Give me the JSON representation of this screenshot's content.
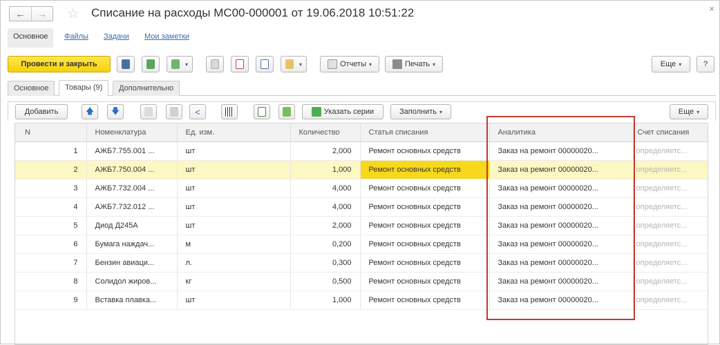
{
  "window": {
    "title": "Списание на расходы МС00-000001 от 19.06.2018 10:51:22",
    "back": "←",
    "forward": "→",
    "star": "☆",
    "close": "×"
  },
  "section_nav": {
    "active": "Основное",
    "links": [
      "Файлы",
      "Задачи",
      "Мои заметки"
    ]
  },
  "toolbar": {
    "post_close": "Провести и закрыть",
    "reports": "Отчеты",
    "print": "Печать",
    "more": "Еще",
    "help": "?"
  },
  "tabs": [
    "Основное",
    "Товары (9)",
    "Дополнительно"
  ],
  "grid_toolbar": {
    "add": "Добавить",
    "series": "Указать серии",
    "fill": "Заполнить",
    "more": "Еще"
  },
  "table": {
    "columns": [
      "N",
      "Номенклатура",
      "Ед. изм.",
      "Количество",
      "Статья списания",
      "Аналитика",
      "Счет списания"
    ],
    "selected_row": 1,
    "rows": [
      {
        "n": "1",
        "item": "АЖБ7.755.001 ...",
        "unit": "шт",
        "qty": "2,000",
        "article": "Ремонт основных средств",
        "analytics": "Заказ на ремонт 00000020...",
        "account": "определяетс..."
      },
      {
        "n": "2",
        "item": "АЖБ7.750.004 ...",
        "unit": "шт",
        "qty": "1,000",
        "article": "Ремонт основных средств",
        "analytics": "Заказ на ремонт 00000020...",
        "account": "определяетс..."
      },
      {
        "n": "3",
        "item": "АЖБ7.732.004 ...",
        "unit": "шт",
        "qty": "4,000",
        "article": "Ремонт основных средств",
        "analytics": "Заказ на ремонт 00000020...",
        "account": "определяетс..."
      },
      {
        "n": "4",
        "item": "АЖБ7.732.012 ...",
        "unit": "шт",
        "qty": "4,000",
        "article": "Ремонт основных средств",
        "analytics": "Заказ на ремонт 00000020...",
        "account": "определяетс..."
      },
      {
        "n": "5",
        "item": "Диод Д245А",
        "unit": "шт",
        "qty": "2,000",
        "article": "Ремонт основных средств",
        "analytics": "Заказ на ремонт 00000020...",
        "account": "определяетс..."
      },
      {
        "n": "6",
        "item": "Бумага наждач...",
        "unit": "м",
        "qty": "0,200",
        "article": "Ремонт основных средств",
        "analytics": "Заказ на ремонт 00000020...",
        "account": "определяетс..."
      },
      {
        "n": "7",
        "item": "Бензин авиаци...",
        "unit": "л.",
        "qty": "0,300",
        "article": "Ремонт основных средств",
        "analytics": "Заказ на ремонт 00000020...",
        "account": "определяетс..."
      },
      {
        "n": "8",
        "item": "Солидол жиров...",
        "unit": "кг",
        "qty": "0,500",
        "article": "Ремонт основных средств",
        "analytics": "Заказ на ремонт 00000020...",
        "account": "определяетс..."
      },
      {
        "n": "9",
        "item": "Вставка плавка...",
        "unit": "шт",
        "qty": "1,000",
        "article": "Ремонт основных средств",
        "analytics": "Заказ на ремонт 00000020...",
        "account": "определяетс..."
      }
    ]
  },
  "colors": {
    "primary_button": "#f5d20a",
    "selected_row": "#fdf7c3",
    "selected_cell": "#f8d81c",
    "highlight_frame": "#c0392b",
    "link": "#3b6ea5"
  }
}
